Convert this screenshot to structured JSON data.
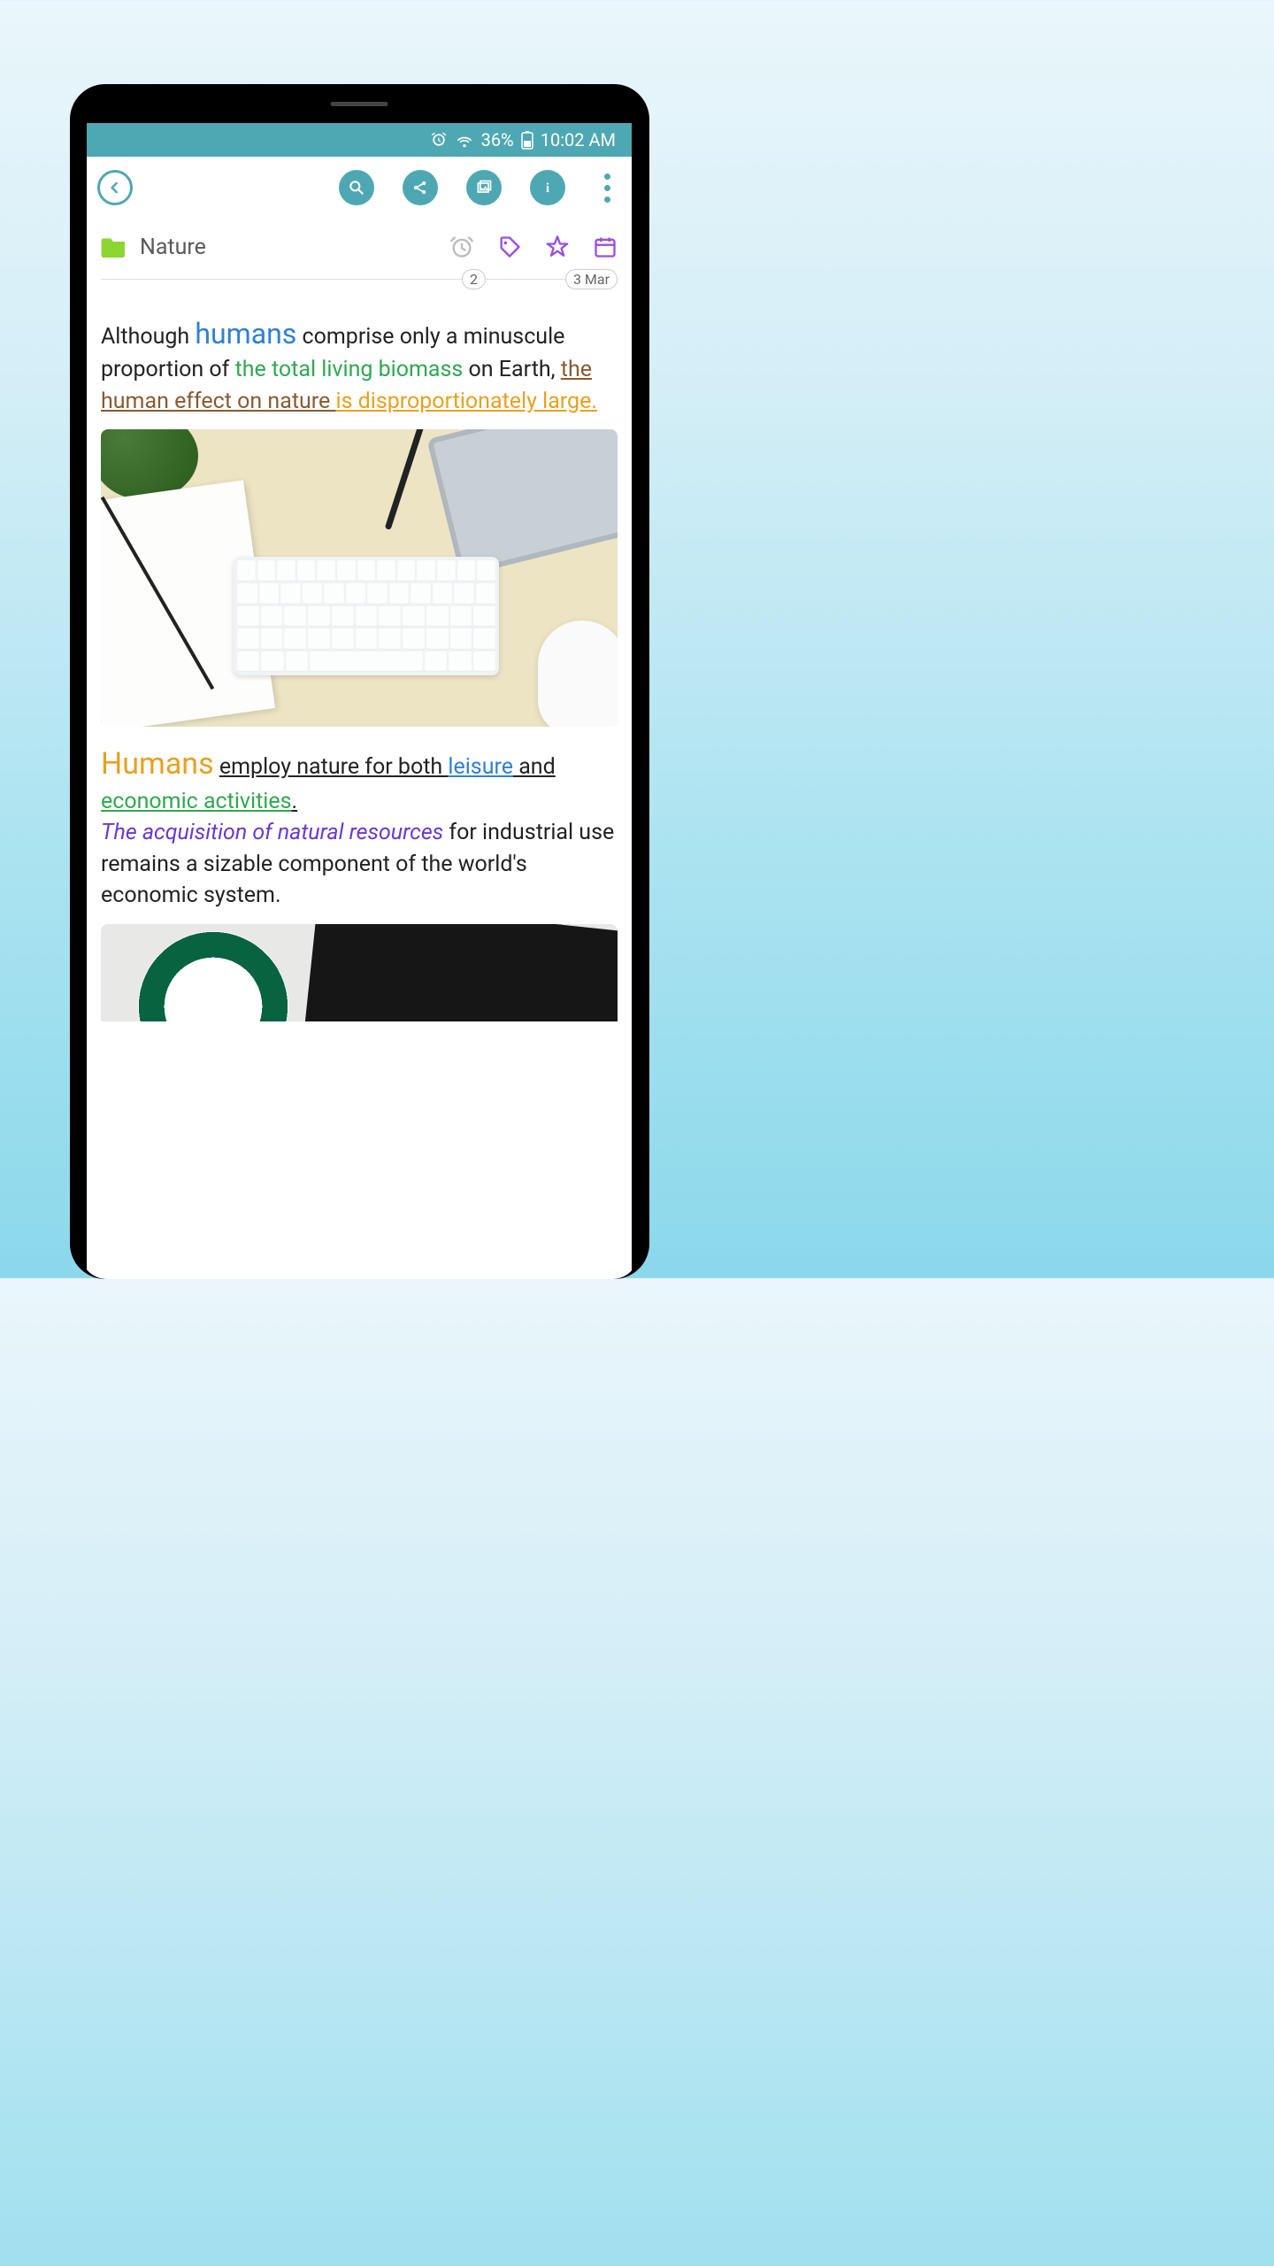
{
  "status": {
    "battery_text": "36%",
    "time": "10:02 AM"
  },
  "folder": {
    "name": "Nature",
    "tag_count": "2",
    "date": "3 Mar"
  },
  "para1": {
    "t1": "Although ",
    "humans": "humans",
    "t2": " comprise only a minus­cule proportion of ",
    "biomass": "the total living biomass",
    "t3": " on Earth, ",
    "effect": "the human effect on nature ",
    "large": "is disproportionately large. "
  },
  "para2": {
    "humans": "Humans",
    "t1": " ",
    "employ": "employ nature for both ",
    "leisure": "leisure",
    "and": " and ",
    "economic": "economic activities",
    "dot": ". ",
    "acq": "The acquisition of natural resources",
    "rest": " for industrial use remains a sizable component of the world's economic system."
  }
}
